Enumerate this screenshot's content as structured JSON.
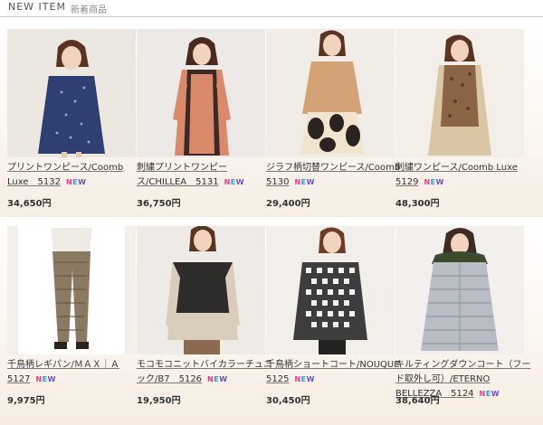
{
  "header": {
    "title_en": "NEW ITEM",
    "title_ja": "新着商品"
  },
  "badge": {
    "n": "N",
    "e": "E",
    "w": "W"
  },
  "products": [
    {
      "name": "プリントワンピース/Coomb Luxe　5132",
      "price": "34,650円"
    },
    {
      "name": "刺繍プリントワンピース/CHILLEA　5131",
      "price": "36,750円"
    },
    {
      "name": "ジラフ柄切替ワンピース/Coomb 5130",
      "price": "29,400円"
    },
    {
      "name": "刺繍ワンピース/Coomb Luxe 5129",
      "price": "48,300円"
    },
    {
      "name": "千鳥柄レギパン/ＭＡＸ｜Ａ 5127",
      "price": "9,975円"
    },
    {
      "name": "モコモコニットバイカラーチュニック/B7　5126",
      "price": "19,950円"
    },
    {
      "name": "千鳥柄ショートコート/NOUQUE 5125",
      "price": "30,450円"
    },
    {
      "name": "キルティングダウンコート（フード取外し可）/ETERNO BELLEZZA　5124",
      "price": "38,640円"
    }
  ]
}
